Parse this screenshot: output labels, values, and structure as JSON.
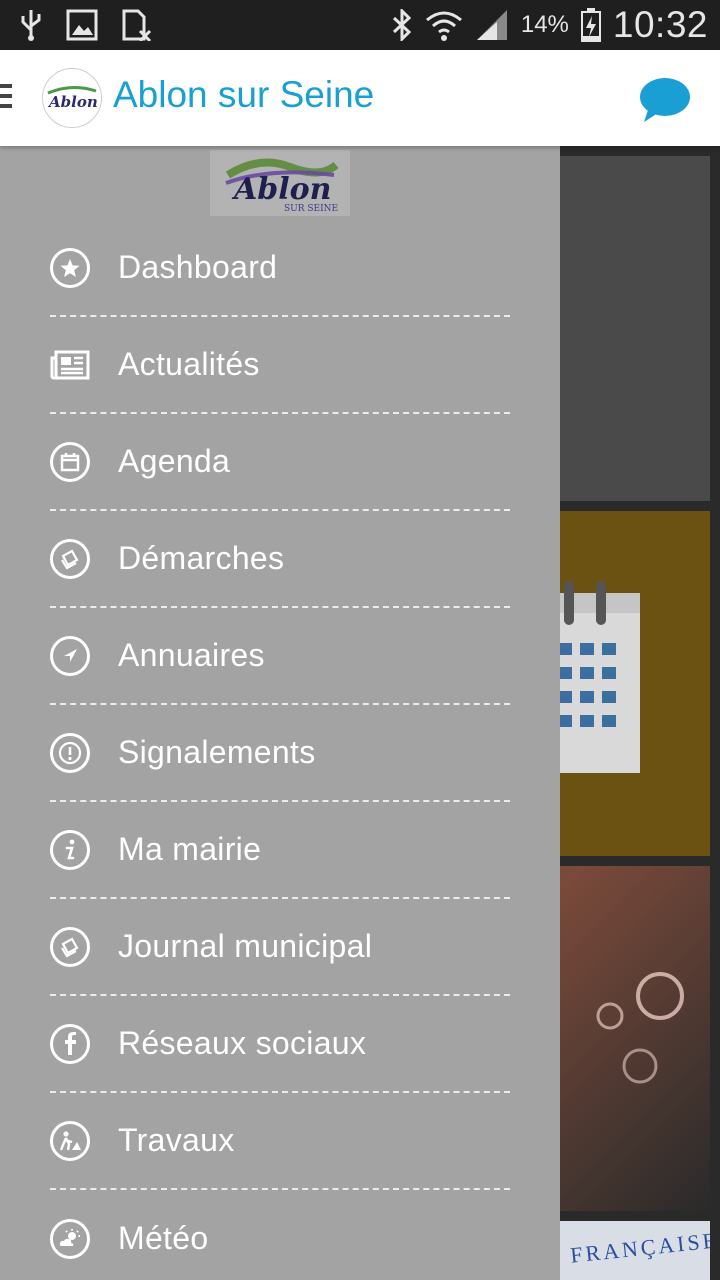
{
  "status_bar": {
    "battery_percent": "14%",
    "time": "10:32"
  },
  "header": {
    "title": "Ablon sur Seine",
    "logo_text": "Ablon",
    "accent_color": "#1a9fd4"
  },
  "drawer": {
    "logo_text": "Ablon",
    "logo_subtext": "SUR SEINE",
    "items": [
      {
        "label": "Dashboard",
        "icon": "star-icon"
      },
      {
        "label": "Actualités",
        "icon": "newspaper-icon"
      },
      {
        "label": "Agenda",
        "icon": "calendar-icon"
      },
      {
        "label": "Démarches",
        "icon": "documents-icon"
      },
      {
        "label": "Annuaires",
        "icon": "compass-icon"
      },
      {
        "label": "Signalements",
        "icon": "alert-icon"
      },
      {
        "label": "Ma mairie",
        "icon": "info-icon"
      },
      {
        "label": "Journal municipal",
        "icon": "documents-icon"
      },
      {
        "label": "Réseaux sociaux",
        "icon": "facebook-icon"
      },
      {
        "label": "Travaux",
        "icon": "roadwork-icon"
      },
      {
        "label": "Météo",
        "icon": "weather-icon"
      }
    ]
  },
  "background": {
    "banner_text": "FRANÇAISE"
  }
}
